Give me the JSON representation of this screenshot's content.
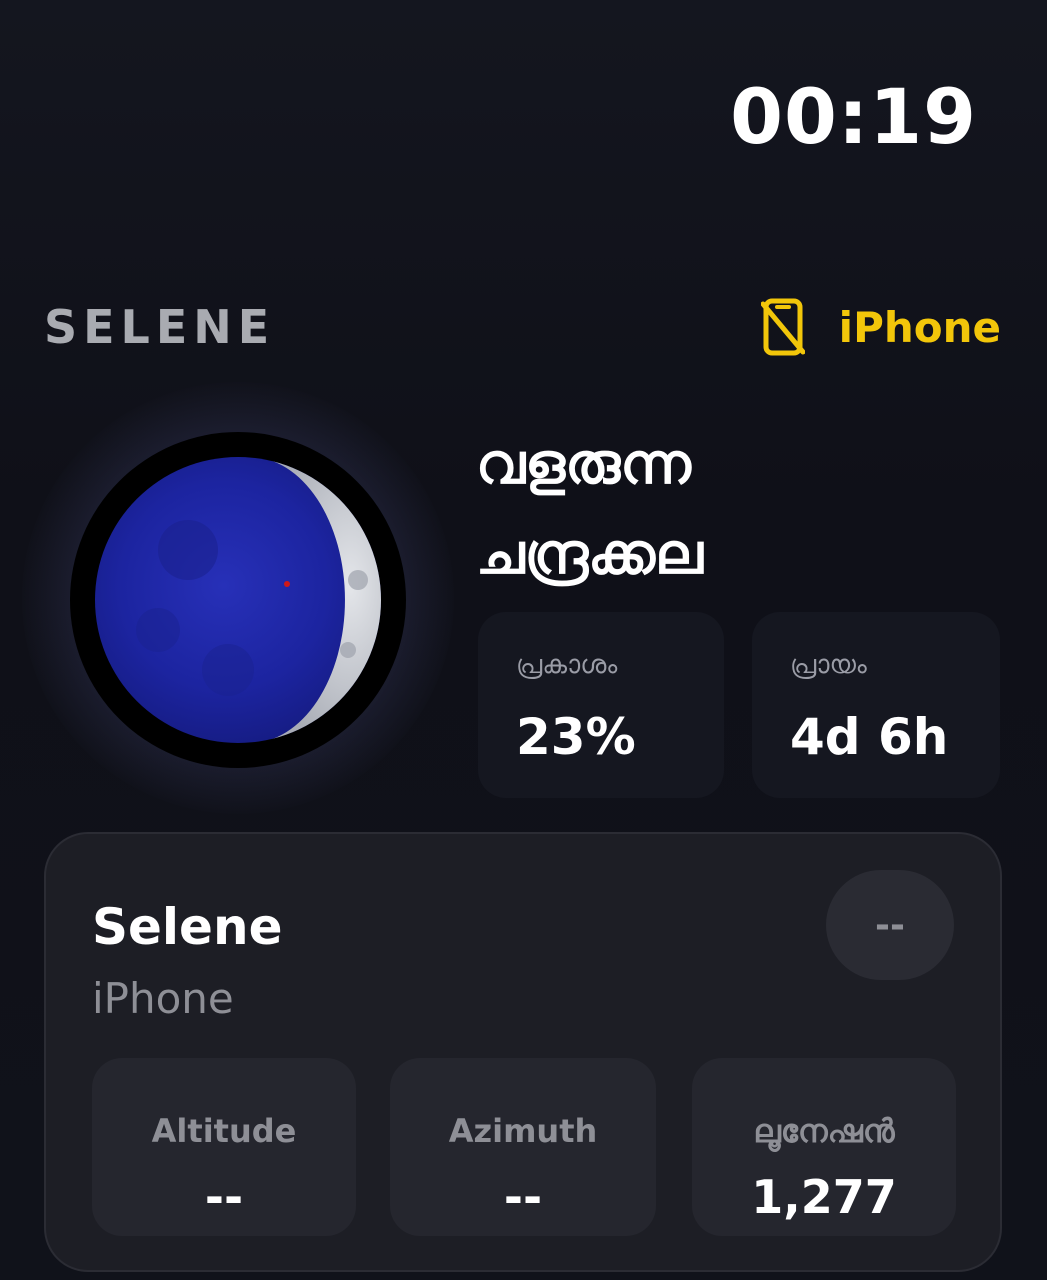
{
  "status_bar": {
    "time": "00:19"
  },
  "header": {
    "brand": "SELENE",
    "device_label": "iPhone",
    "device_icon": "phone-slash-icon",
    "accent_color": "#f2c60a"
  },
  "moon": {
    "icon": "moon-phase-image",
    "phase_name_line1": "വളരുന്ന",
    "phase_name_line2": "ചന്ദ്രക്കല"
  },
  "stats": {
    "illumination": {
      "label": "പ്രകാശം",
      "value": "23%"
    },
    "age": {
      "label": "പ്രായം",
      "value": "4d 6h"
    }
  },
  "card": {
    "title": "Selene",
    "subtitle": "iPhone",
    "pill": "--",
    "metrics": [
      {
        "label": "Altitude",
        "value": "--"
      },
      {
        "label": "Azimuth",
        "value": "--"
      },
      {
        "label": "ലൂനേഷൻ",
        "value": "1,277"
      }
    ]
  }
}
